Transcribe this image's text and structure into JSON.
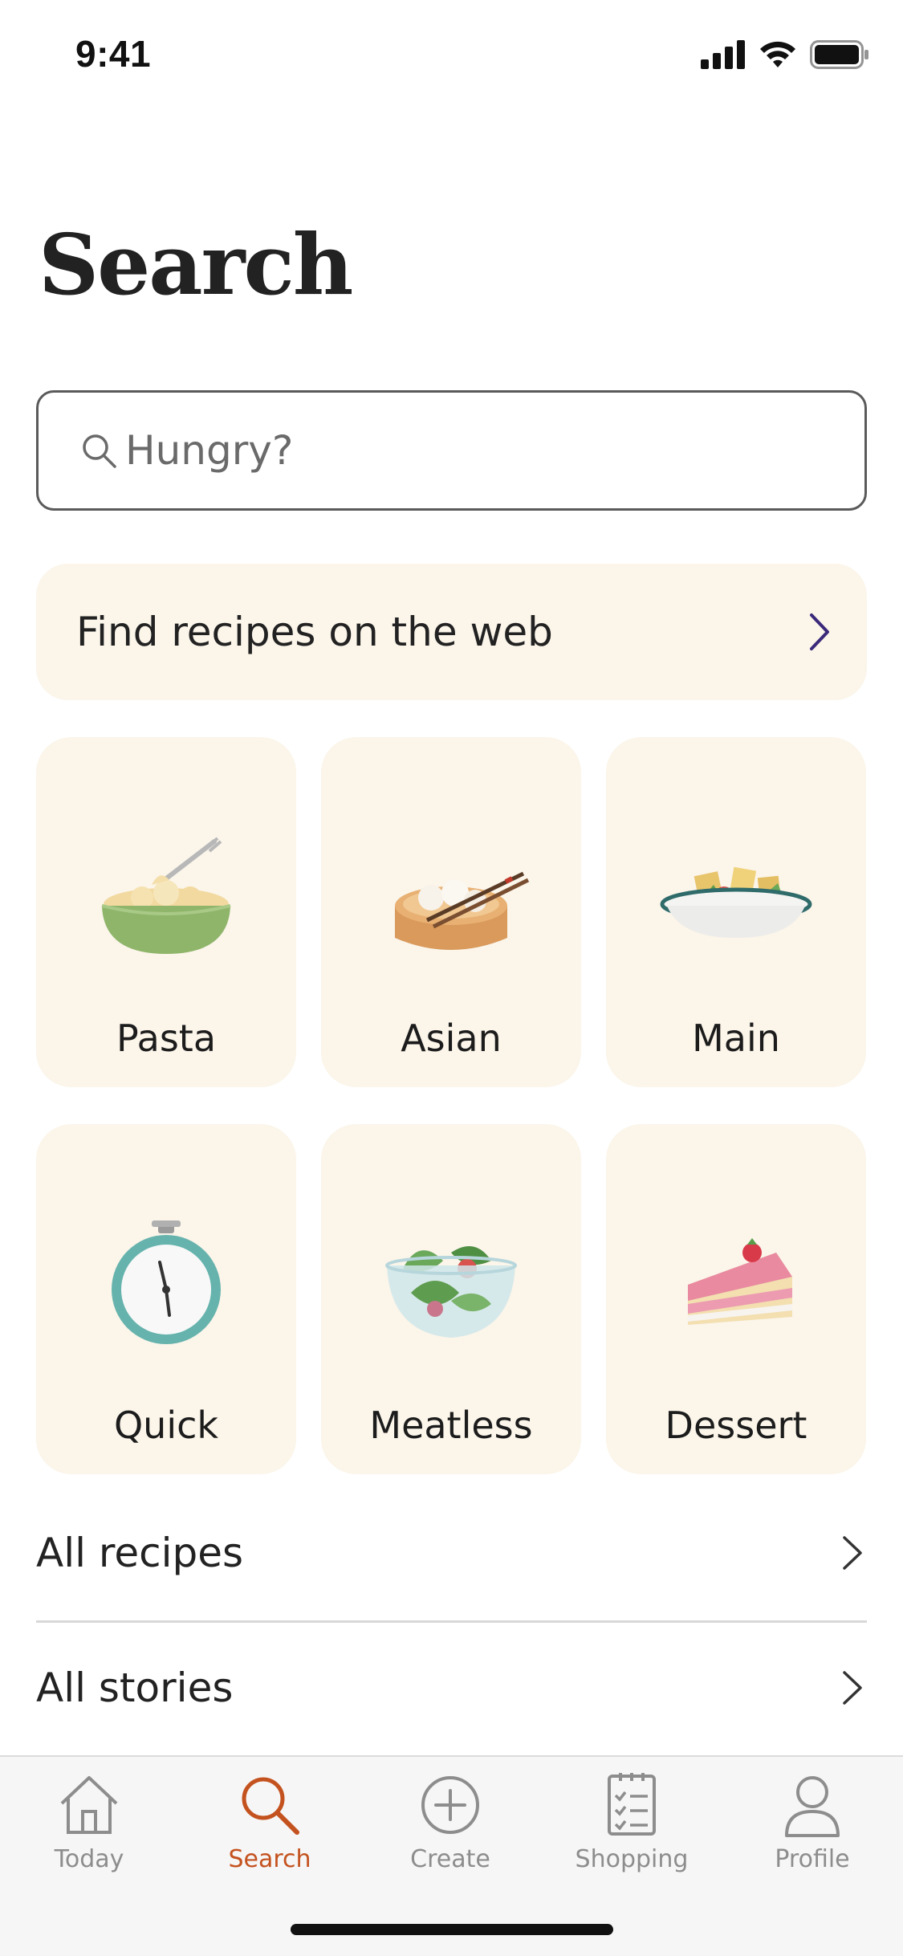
{
  "status_bar": {
    "time": "9:41"
  },
  "page": {
    "title": "Search"
  },
  "search": {
    "placeholder": "Hungry?"
  },
  "web_banner": {
    "label": "Find recipes on the web"
  },
  "categories": [
    {
      "label": "Pasta",
      "icon": "pasta-bowl-icon"
    },
    {
      "label": "Asian",
      "icon": "dim-sum-basket-icon"
    },
    {
      "label": "Main",
      "icon": "main-dish-bowl-icon"
    },
    {
      "label": "Quick",
      "icon": "stopwatch-icon"
    },
    {
      "label": "Meatless",
      "icon": "salad-bowl-icon"
    },
    {
      "label": "Dessert",
      "icon": "cake-slice-icon"
    }
  ],
  "links": [
    {
      "label": "All recipes"
    },
    {
      "label": "All stories"
    }
  ],
  "tab_bar": {
    "tabs": [
      {
        "label": "Today",
        "icon": "house-icon"
      },
      {
        "label": "Search",
        "icon": "search-icon"
      },
      {
        "label": "Create",
        "icon": "plus-circle-icon"
      },
      {
        "label": "Shopping",
        "icon": "checklist-icon"
      },
      {
        "label": "Profile",
        "icon": "person-icon"
      }
    ],
    "active": "Search"
  },
  "colors": {
    "accent": "#c4521f",
    "tile_background": "#fbf5ea",
    "chevron_accent": "#3b2a7a"
  }
}
